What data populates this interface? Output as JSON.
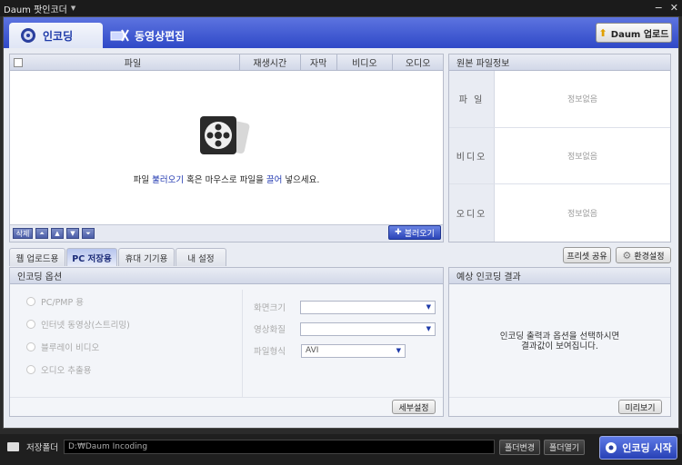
{
  "app": {
    "title": "Daum 팟인코더"
  },
  "nav": {
    "encode_tab": "인코딩",
    "edit_tab": "동영상편집",
    "upload_button": "Daum 업로드"
  },
  "file_list": {
    "columns": [
      "파일",
      "재생시간",
      "자막",
      "비디오",
      "오디오"
    ],
    "empty_message": {
      "part1": "파일 ",
      "link1": "불러오기",
      "part2": " 혹은 마우스로 파일을 ",
      "link2": "끌어",
      "part3": " 넣으세요."
    },
    "delete_label": "삭제",
    "load_button": "불러오기"
  },
  "source_info": {
    "title": "원본 파일정보",
    "rows": [
      {
        "label": "파 일",
        "value": "정보없음"
      },
      {
        "label": "비디오",
        "value": "정보없음"
      },
      {
        "label": "오디오",
        "value": "정보없음"
      }
    ]
  },
  "subtabs": [
    "웹 업로드용",
    "PC 저장용",
    "휴대 기기용",
    "내 설정"
  ],
  "preset_share_button": "프리셋 공유",
  "settings_button": "환경설정",
  "options": {
    "title": "인코딩 옵션",
    "radios": [
      "PC/PMP 용",
      "인터넷 동영상(스트리밍)",
      "블루레이 비디오",
      "오디오 추출용"
    ],
    "fields": [
      {
        "label": "화면크기",
        "value": ""
      },
      {
        "label": "영상화질",
        "value": ""
      },
      {
        "label": "파일형식",
        "value": "AVI"
      }
    ],
    "detail_button": "세부설정"
  },
  "result": {
    "title": "예상 인코딩 결과",
    "message_line1": "인코딩 출력과 옵션을 선택하시면",
    "message_line2": "결과값이 보여집니다.",
    "preview_button": "미리보기"
  },
  "bottom": {
    "folder_label": "저장폴더",
    "path": "D:₩Daum Incoding",
    "change_folder": "폴더변경",
    "open_folder": "폴더열기",
    "start_button": "인코딩 시작"
  }
}
